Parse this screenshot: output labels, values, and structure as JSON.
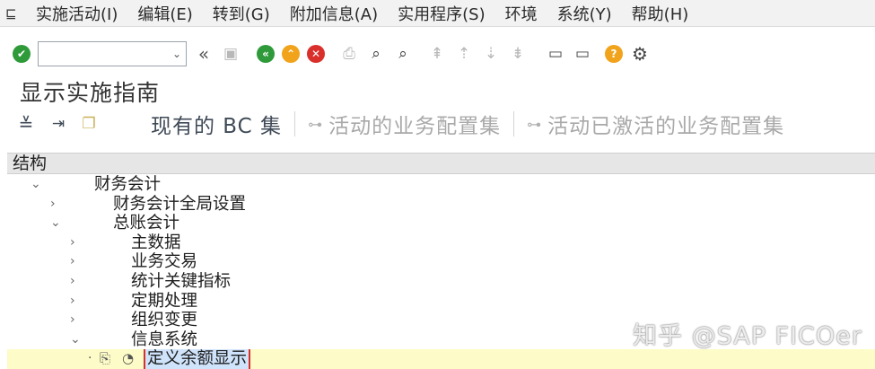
{
  "menu": {
    "items": [
      "实施活动(I)",
      "编辑(E)",
      "转到(G)",
      "附加信息(A)",
      "实用程序(S)",
      "环境",
      "系统(Y)",
      "帮助(H)"
    ]
  },
  "toolbar": {
    "command_field_value": "",
    "icons": [
      "enter-icon",
      "back-icon",
      "save-icon",
      "back-nav-icon",
      "exit-icon",
      "cancel-icon",
      "print-icon",
      "find-icon",
      "find-next-icon",
      "first-page-icon",
      "prev-page-icon",
      "next-page-icon",
      "last-page-icon",
      "create-session-icon",
      "shortcut-icon",
      "help-icon",
      "settings-icon"
    ]
  },
  "page": {
    "title": "显示实施指南"
  },
  "app_toolbar": {
    "existing_bc_sets": "现有的 BC 集",
    "active_bc_sets": "活动的业务配置集",
    "activated_bc_sets": "活动已激活的业务配置集"
  },
  "tree": {
    "header": "结构",
    "nodes": [
      {
        "label": "财务会计",
        "expanded": true
      },
      {
        "label": "财务会计全局设置",
        "expanded": false
      },
      {
        "label": "总账会计",
        "expanded": true
      },
      {
        "label": "主数据",
        "expanded": false
      },
      {
        "label": "业务交易",
        "expanded": false
      },
      {
        "label": "统计关键指标",
        "expanded": false
      },
      {
        "label": "定期处理",
        "expanded": false
      },
      {
        "label": "组织变更",
        "expanded": false
      },
      {
        "label": "信息系统",
        "expanded": true
      },
      {
        "label": "定义余额显示",
        "selected": true
      }
    ]
  },
  "watermark": "知乎 @SAP FICOer",
  "colors": {
    "selected_row": "#fdfcc8",
    "selection_highlight": "#cfe3fb",
    "selection_border": "#d9302b"
  }
}
